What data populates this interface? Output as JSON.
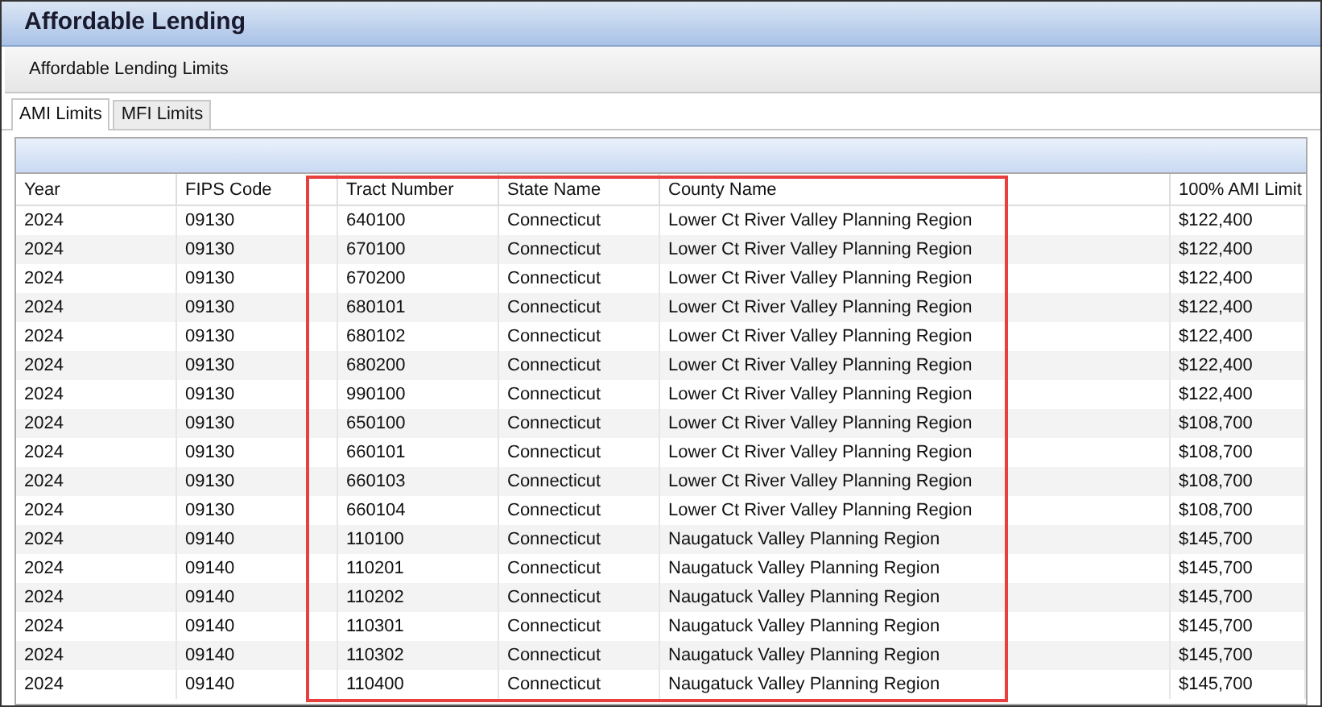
{
  "window": {
    "title": "Affordable Lending"
  },
  "subtitle": "Affordable Lending Limits",
  "tabs": [
    {
      "label": "AMI Limits",
      "selected": true
    },
    {
      "label": "MFI Limits",
      "selected": false
    }
  ],
  "table": {
    "columns": [
      "Year",
      "FIPS Code",
      "Tract Number",
      "State Name",
      "County Name",
      "100% AMI Limit"
    ],
    "rows": [
      [
        "2024",
        "09130",
        "640100",
        "Connecticut",
        "Lower Ct River Valley Planning Region",
        "$122,400"
      ],
      [
        "2024",
        "09130",
        "670100",
        "Connecticut",
        "Lower Ct River Valley Planning Region",
        "$122,400"
      ],
      [
        "2024",
        "09130",
        "670200",
        "Connecticut",
        "Lower Ct River Valley Planning Region",
        "$122,400"
      ],
      [
        "2024",
        "09130",
        "680101",
        "Connecticut",
        "Lower Ct River Valley Planning Region",
        "$122,400"
      ],
      [
        "2024",
        "09130",
        "680102",
        "Connecticut",
        "Lower Ct River Valley Planning Region",
        "$122,400"
      ],
      [
        "2024",
        "09130",
        "680200",
        "Connecticut",
        "Lower Ct River Valley Planning Region",
        "$122,400"
      ],
      [
        "2024",
        "09130",
        "990100",
        "Connecticut",
        "Lower Ct River Valley Planning Region",
        "$122,400"
      ],
      [
        "2024",
        "09130",
        "650100",
        "Connecticut",
        "Lower Ct River Valley Planning Region",
        "$108,700"
      ],
      [
        "2024",
        "09130",
        "660101",
        "Connecticut",
        "Lower Ct River Valley Planning Region",
        "$108,700"
      ],
      [
        "2024",
        "09130",
        "660103",
        "Connecticut",
        "Lower Ct River Valley Planning Region",
        "$108,700"
      ],
      [
        "2024",
        "09130",
        "660104",
        "Connecticut",
        "Lower Ct River Valley Planning Region",
        "$108,700"
      ],
      [
        "2024",
        "09140",
        "110100",
        "Connecticut",
        "Naugatuck Valley Planning Region",
        "$145,700"
      ],
      [
        "2024",
        "09140",
        "110201",
        "Connecticut",
        "Naugatuck Valley Planning Region",
        "$145,700"
      ],
      [
        "2024",
        "09140",
        "110202",
        "Connecticut",
        "Naugatuck Valley Planning Region",
        "$145,700"
      ],
      [
        "2024",
        "09140",
        "110301",
        "Connecticut",
        "Naugatuck Valley Planning Region",
        "$145,700"
      ],
      [
        "2024",
        "09140",
        "110302",
        "Connecticut",
        "Naugatuck Valley Planning Region",
        "$145,700"
      ],
      [
        "2024",
        "09140",
        "110400",
        "Connecticut",
        "Naugatuck Valley Planning Region",
        "$145,700"
      ]
    ]
  }
}
